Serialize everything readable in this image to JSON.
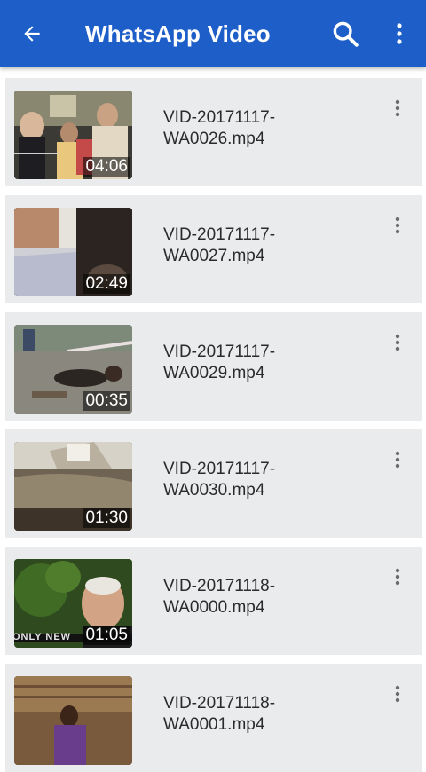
{
  "app_bar": {
    "title": "WhatsApp Video",
    "color": "#1d5ec8",
    "icons": [
      "back-arrow-icon",
      "search-icon",
      "more-vert-icon"
    ]
  },
  "videos": [
    {
      "name": "VID-20171117-\nWA0026.mp4",
      "duration": "04:06"
    },
    {
      "name": "VID-20171117-\nWA0027.mp4",
      "duration": "02:49"
    },
    {
      "name": "VID-20171117-\nWA0029.mp4",
      "duration": "00:35"
    },
    {
      "name": "VID-20171117-\nWA0030.mp4",
      "duration": "01:30"
    },
    {
      "name": "VID-20171118-\nWA0000.mp4",
      "duration": "01:05"
    },
    {
      "name": "VID-20171118-\nWA0001.mp4",
      "duration": ""
    }
  ],
  "thumb_overlay_text": "ONLY NEW",
  "colors": {
    "card_bg": "#e9ebed",
    "text": "#2b2b2b"
  }
}
